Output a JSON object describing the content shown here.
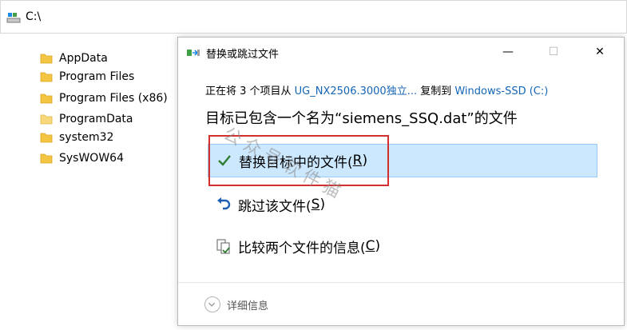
{
  "address_bar": {
    "path": "C:\\",
    "icon": "drive-icon"
  },
  "tree": {
    "items": [
      {
        "label": "AppData",
        "icon": "folder-icon"
      },
      {
        "label": "Program Files",
        "icon": "folder-icon"
      },
      {
        "label": "Program Files (x86)",
        "icon": "folder-icon"
      },
      {
        "label": "ProgramData",
        "icon": "folder-icon"
      },
      {
        "label": "system32",
        "icon": "folder-icon"
      },
      {
        "label": "SysWOW64",
        "icon": "folder-icon"
      }
    ]
  },
  "dialog": {
    "title": "替换或跳过文件",
    "window_buttons": {
      "minimize": "—",
      "maximize": "☐",
      "close": "✕"
    },
    "copy_prefix": "正在将 3 个项目从 ",
    "copy_source": "UG_NX2506.3000独立...",
    "copy_middle": " 复制到 ",
    "copy_dest": "Windows-SSD (C:)",
    "headline": "目标已包含一个名为“siemens_SSQ.dat”的文件",
    "options": {
      "replace": {
        "label": "替换目标中的文件(",
        "key": "R",
        "suffix": ")",
        "icon": "checkmark-icon"
      },
      "skip": {
        "label": "跳过该文件(",
        "key": "S",
        "suffix": ")",
        "icon": "undo-arrow-icon"
      },
      "compare": {
        "label": "比较两个文件的信息(",
        "key": "C",
        "suffix": ")",
        "icon": "compare-files-icon"
      }
    },
    "details_label": "详细信息"
  },
  "watermark": "公众号软件猫",
  "colors": {
    "accent": "#1565b6",
    "selected_bg": "#cce8ff",
    "highlight_border": "#d32f2f",
    "folder": "#f4c542"
  }
}
